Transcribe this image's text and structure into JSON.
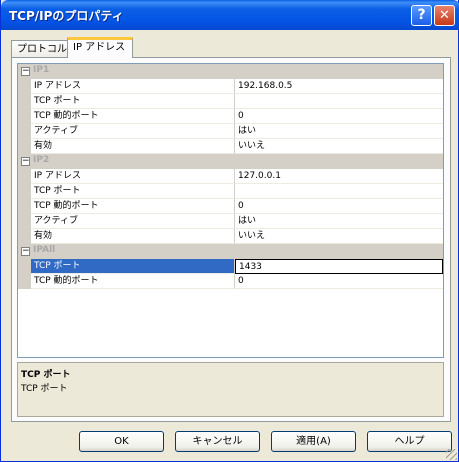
{
  "window": {
    "title": "TCP/IPのプロパティ",
    "help_glyph": "?",
    "close_glyph": "✕"
  },
  "tabs": [
    {
      "label": "プロトコル"
    },
    {
      "label": "IP アドレス"
    }
  ],
  "grid": {
    "sections": [
      {
        "toggle": "−",
        "name": "IP1",
        "rows": [
          {
            "name": "IP アドレス",
            "value": "192.168.0.5"
          },
          {
            "name": "TCP ポート",
            "value": ""
          },
          {
            "name": "TCP 動的ポート",
            "value": "0"
          },
          {
            "name": "アクティブ",
            "value": "はい"
          },
          {
            "name": "有効",
            "value": "いいえ"
          }
        ]
      },
      {
        "toggle": "−",
        "name": "IP2",
        "rows": [
          {
            "name": "IP アドレス",
            "value": "127.0.0.1"
          },
          {
            "name": "TCP ポート",
            "value": ""
          },
          {
            "name": "TCP 動的ポート",
            "value": "0"
          },
          {
            "name": "アクティブ",
            "value": "はい"
          },
          {
            "name": "有効",
            "value": "いいえ"
          }
        ]
      },
      {
        "toggle": "−",
        "name": "IPAll",
        "rows": [
          {
            "name": "TCP ポート",
            "value": "1433"
          },
          {
            "name": "TCP 動的ポート",
            "value": "0"
          }
        ]
      }
    ]
  },
  "description": {
    "title": "TCP ポート",
    "text": "TCP ポート"
  },
  "buttons": {
    "ok": "OK",
    "cancel": "キャンセル",
    "apply": "適用(A)",
    "help": "ヘルプ"
  }
}
